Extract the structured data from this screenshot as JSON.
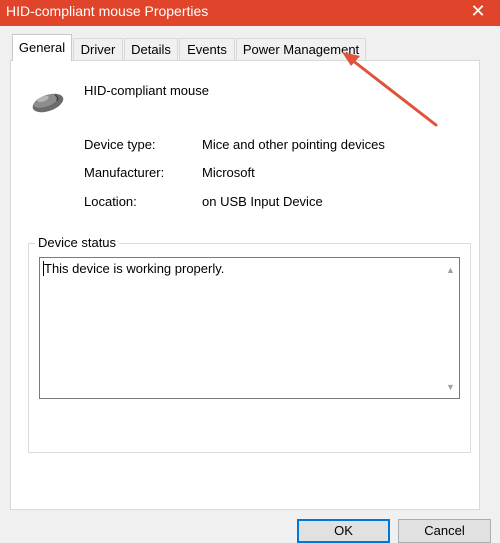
{
  "window": {
    "title": "HID-compliant mouse Properties",
    "close_glyph": "✕"
  },
  "tabs": [
    {
      "label": "General",
      "active": true
    },
    {
      "label": "Driver",
      "active": false
    },
    {
      "label": "Details",
      "active": false
    },
    {
      "label": "Events",
      "active": false
    },
    {
      "label": "Power Management",
      "active": false
    }
  ],
  "device": {
    "icon": "mouse-icon",
    "name": "HID-compliant mouse",
    "properties": [
      {
        "label": "Device type:",
        "value": "Mice and other pointing devices"
      },
      {
        "label": "Manufacturer:",
        "value": "Microsoft"
      },
      {
        "label": "Location:",
        "value": "on USB Input Device"
      }
    ]
  },
  "status": {
    "group_label": "Device status",
    "text": "This device is working properly."
  },
  "buttons": {
    "ok": "OK",
    "cancel": "Cancel"
  },
  "annotation": {
    "arrow_color": "#e0533b",
    "points_to": "tab-power-management"
  },
  "colors": {
    "titlebar": "#e0442a",
    "default_button_border": "#0078d7"
  }
}
